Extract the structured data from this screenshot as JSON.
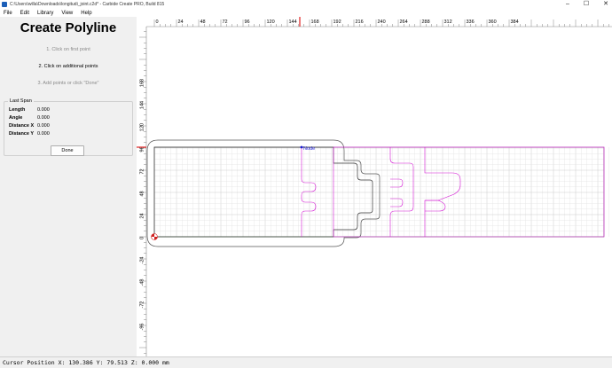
{
  "window": {
    "title": "C:\\Users\\willa\\Downloads\\longitudi_joint.c2d* - Carbide Create PRO, Build 815",
    "minimize": "–",
    "maximize": "☐",
    "close": "✕"
  },
  "menu": [
    "File",
    "Edit",
    "Library",
    "View",
    "Help"
  ],
  "panel": {
    "title": "Create Polyline",
    "steps": [
      "1. Click on first point",
      "2. Click on additional points",
      "3. Add points or click \"Done\""
    ],
    "last_span": {
      "label": "Last Span",
      "rows": [
        {
          "label": "Length",
          "value": "0.000"
        },
        {
          "label": "Angle",
          "value": "0.000"
        },
        {
          "label": "Distance X",
          "value": "0.000"
        },
        {
          "label": "Distance Y",
          "value": "0.000"
        }
      ]
    },
    "done_label": "Done"
  },
  "canvas": {
    "ruler_x_labels": [
      "0",
      "24",
      "48",
      "72",
      "96",
      "120",
      "144",
      "168",
      "192",
      "216",
      "240",
      "264",
      "288",
      "312",
      "336",
      "360",
      "384"
    ],
    "ruler_y_labels": [
      "168",
      "144",
      "120",
      "96",
      "72",
      "48",
      "24",
      "0",
      "-24",
      "-48",
      "-72",
      "-96"
    ],
    "node_label": "Node",
    "colors": {
      "grid_minor": "#e3e3e3",
      "grid_major": "#c2c2c2",
      "stock": "#7a7a7a",
      "selected": "#d418d4",
      "node": "#1a1ad8",
      "cursor": "#e02020"
    }
  },
  "status": {
    "text": "Cursor Position X: 130.386 Y: 79.513 Z: 0.000 mm"
  }
}
